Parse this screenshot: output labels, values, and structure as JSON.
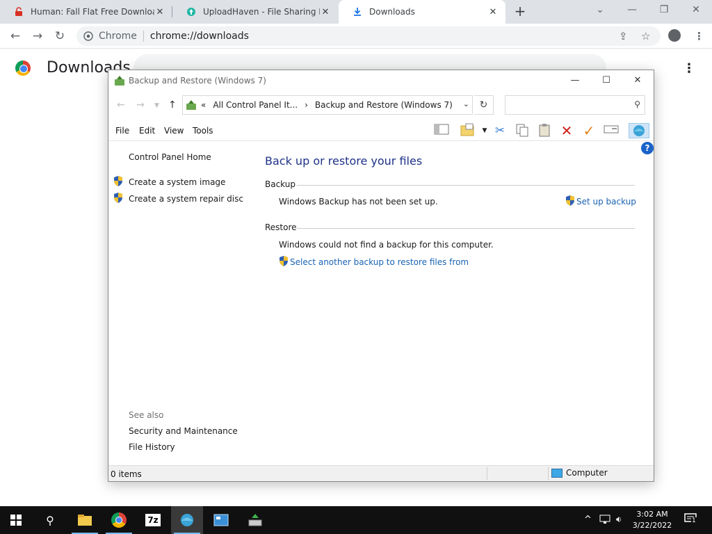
{
  "browser": {
    "tabs": [
      {
        "title": "Human: Fall Flat Free Download (",
        "close": "✕"
      },
      {
        "title": "UploadHaven - File Sharing Made",
        "close": "✕"
      },
      {
        "title": "Downloads",
        "close": "✕"
      }
    ],
    "new_tab": "+",
    "site_label": "Chrome",
    "url": "chrome://downloads"
  },
  "downloads_page": {
    "title": "Downloads"
  },
  "explorer": {
    "title": "Backup and Restore (Windows 7)",
    "breadcrumb": [
      "All Control Panel It...",
      "Backup and Restore (Windows 7)"
    ],
    "breadcrumb_prefix": "«",
    "search_placeholder": "",
    "menus": [
      "File",
      "Edit",
      "View",
      "Tools"
    ],
    "left_pane": {
      "home": "Control Panel Home",
      "tasks": [
        "Create a system image",
        "Create a system repair disc"
      ],
      "see_also_label": "See also",
      "see_also": [
        "Security and Maintenance",
        "File History"
      ]
    },
    "content": {
      "heading": "Back up or restore your files",
      "backup_label": "Backup",
      "backup_status": "Windows Backup has not been set up.",
      "setup_link": "Set up backup",
      "restore_label": "Restore",
      "restore_status": "Windows could not find a backup for this computer.",
      "restore_link": "Select another backup to restore files from"
    },
    "help": "?",
    "status": {
      "items": "0 items",
      "location": "Computer"
    }
  },
  "taskbar": {
    "time": "3:02 AM",
    "date": "3/22/2022",
    "notification_count": "1",
    "zip_label": "7z"
  },
  "colors": {
    "link": "#1a63b3",
    "heading": "#1e3287",
    "taskbar": "#101010"
  }
}
